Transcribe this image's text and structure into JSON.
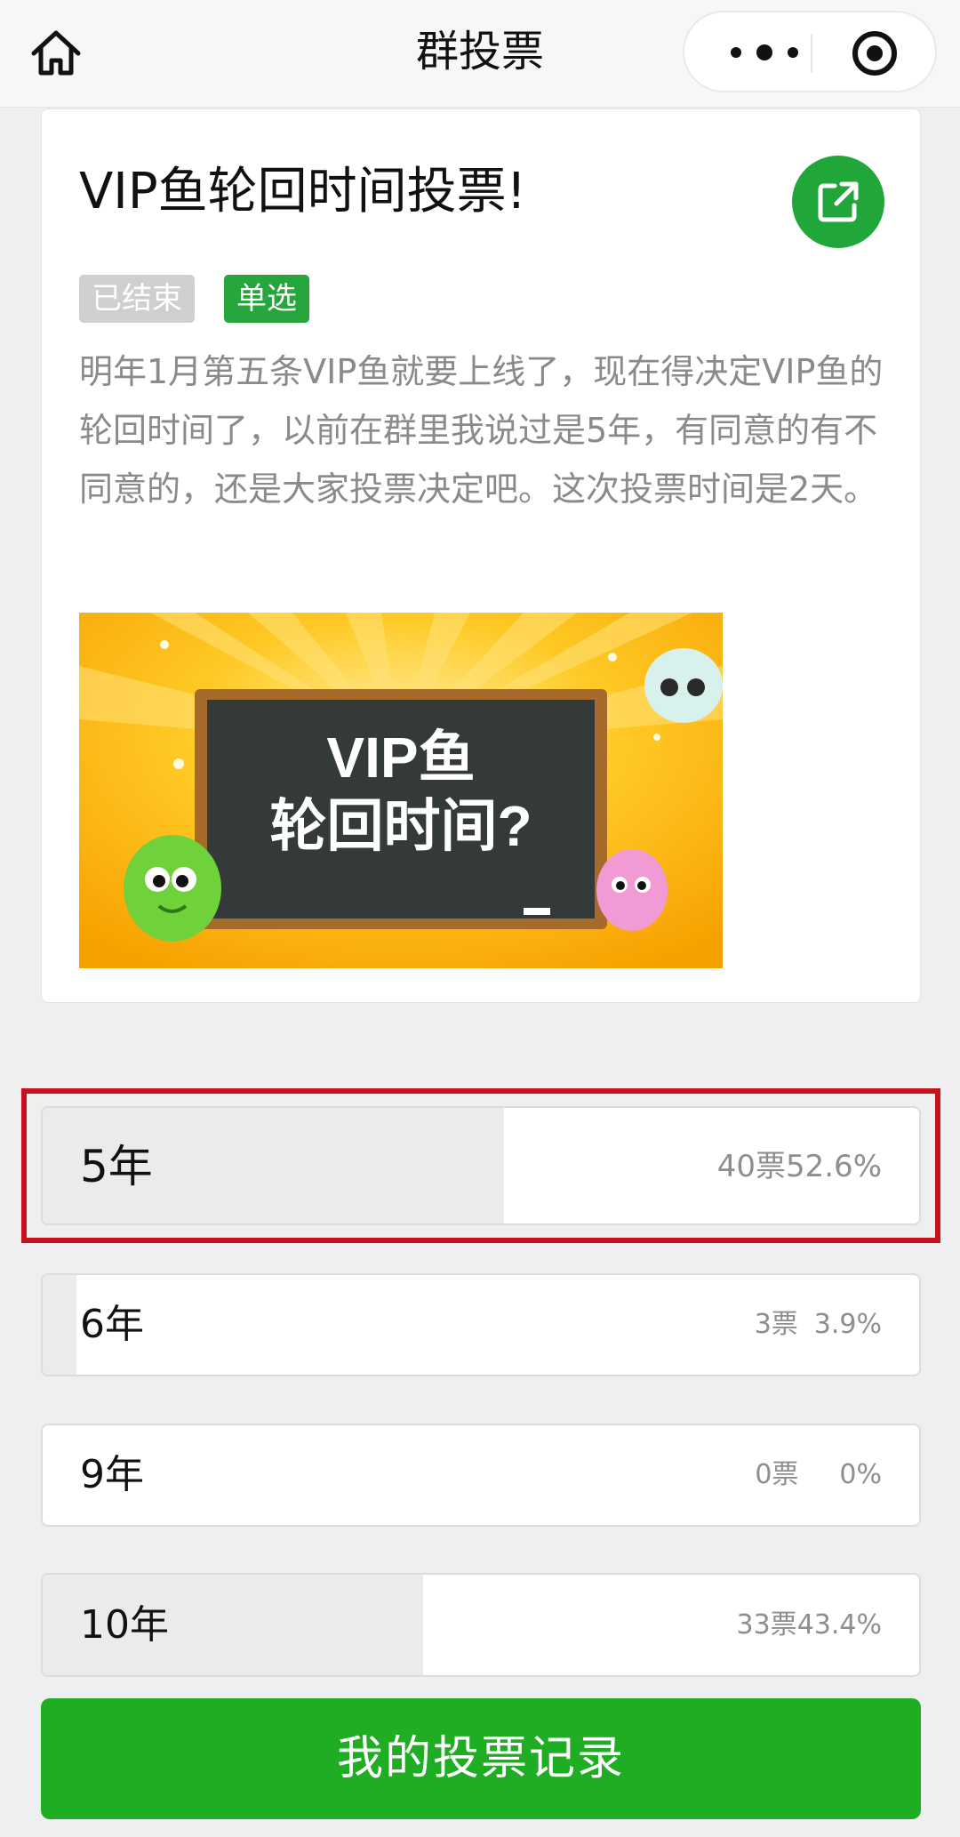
{
  "navbar": {
    "title": "群投票",
    "home_icon": "home-icon",
    "more_icon": "more-dots-icon",
    "close_icon": "target-close-icon"
  },
  "poll": {
    "title": "VIP鱼轮回时间投票!",
    "share_icon": "share-external-icon",
    "tags": {
      "ended": "已结束",
      "single": "单选"
    },
    "description": "明年1月第五条VIP鱼就要上线了，现在得决定VIP鱼的轮回时间了，以前在群里我说过是5年，有同意的有不同意的，还是大家投票决定吧。这次投票时间是2天。",
    "image": {
      "line1": "VIP鱼",
      "line2": "轮回时间?"
    }
  },
  "options": [
    {
      "label": "5年",
      "votes": "40票",
      "percent": "52.6%",
      "fraction": 0.526,
      "selected": true
    },
    {
      "label": "6年",
      "votes": "3票",
      "percent": "3.9%",
      "fraction": 0.039,
      "selected": false
    },
    {
      "label": "9年",
      "votes": "0票",
      "percent": "0%",
      "fraction": 0.0,
      "selected": false
    },
    {
      "label": "10年",
      "votes": "33票",
      "percent": "43.4%",
      "fraction": 0.434,
      "selected": false
    }
  ],
  "footer": {
    "records_button": "我的投票记录"
  },
  "colors": {
    "brand_green": "#1fad23",
    "tag_green": "#26a63c",
    "highlight_red": "#c5121b",
    "bar_gray": "#ebebeb"
  }
}
